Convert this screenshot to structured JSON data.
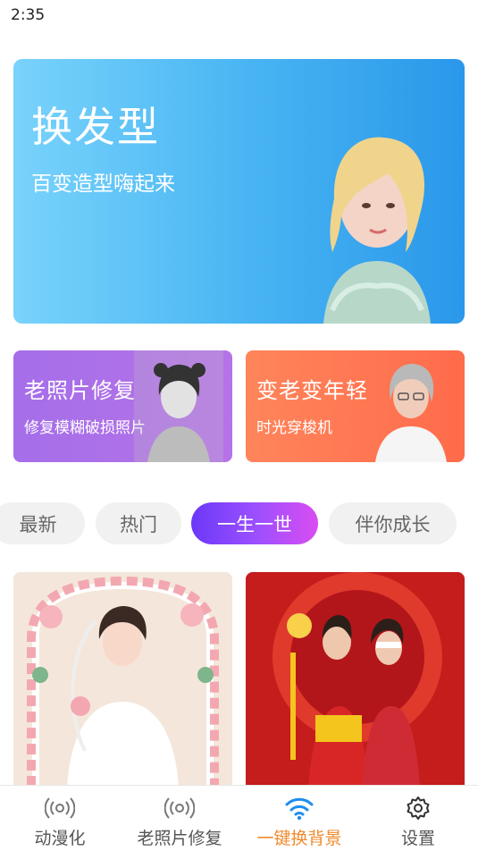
{
  "status": {
    "time": "2:35"
  },
  "hero": {
    "title": "换发型",
    "subtitle": "百变造型嗨起来"
  },
  "cards": [
    {
      "title": "老照片修复",
      "subtitle": "修复模糊破损照片"
    },
    {
      "title": "变老变年轻",
      "subtitle": "时光穿梭机"
    }
  ],
  "tabs": [
    {
      "label": "最新"
    },
    {
      "label": "热门"
    },
    {
      "label": "一生一世",
      "active": true
    },
    {
      "label": "伴你成长"
    }
  ],
  "bottom_nav": [
    {
      "label": "动漫化",
      "icon": "broadcast-icon"
    },
    {
      "label": "老照片修复",
      "icon": "broadcast-icon"
    },
    {
      "label": "一键换背景",
      "icon": "wifi-icon",
      "active": true
    },
    {
      "label": "设置",
      "icon": "gear-icon"
    }
  ],
  "colors": {
    "accent_orange": "#f08a2c",
    "tab_active_start": "#6b38f7",
    "tab_active_end": "#d84ef1",
    "hero_start": "#79d3fb",
    "hero_end": "#2a97ea"
  }
}
